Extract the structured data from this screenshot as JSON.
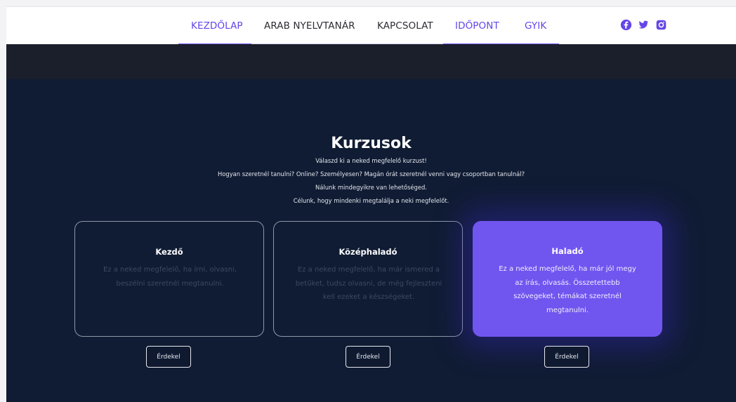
{
  "nav": {
    "items": [
      {
        "label": "KEZDŐLAP",
        "active": true
      },
      {
        "label": "ARAB NYELVTANÁR",
        "active": false
      },
      {
        "label": "KAPCSOLAT",
        "active": false
      },
      {
        "label": "IDŐPONT",
        "active": true
      },
      {
        "label": "GYIK",
        "active": false
      }
    ],
    "social": [
      "facebook-icon",
      "twitter-icon",
      "instagram-icon"
    ]
  },
  "courses": {
    "title": "Kurzusok",
    "intro": [
      "Válaszd ki a neked megfelelő kurzust!",
      "Hogyan szeretnél tanulni? Online? Személyesen? Magán órát szeretnél venni vagy csoportban tanulnál?",
      "Nálunk mindegyikre van lehetőséged.",
      "Célunk, hogy mindenki megtalálja a neki megfelelőt."
    ],
    "cards": [
      {
        "title": "Kezdő",
        "text": "Ez a neked megfelelő, ha írni, olvasni, beszélni szeretnél megtanulni.",
        "button": "Érdekel"
      },
      {
        "title": "Középhaladó",
        "text": "Ez a neked megfelelő, ha már ismered a betűket, tudsz olvasni, de még fejleszteni kell ezeket a készségeket.",
        "button": "Érdekel"
      },
      {
        "title": "Haladó",
        "text": "Ez a neked megfelelő, ha már jól megy az írás, olvasás. Összetettebb szövegeket, témákat szeretnél megtanulni.",
        "button": "Érdekel"
      }
    ]
  },
  "colors": {
    "accent": "#7155ef",
    "background": "#101c33",
    "nav_active": "#6445e8"
  }
}
